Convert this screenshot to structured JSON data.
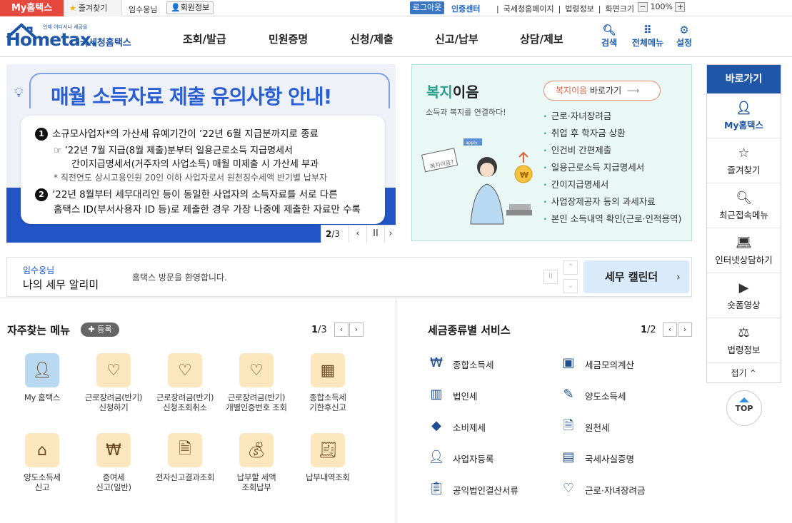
{
  "topbar": {
    "my_hometax": "My홈택스",
    "favorites": "즐겨찾기",
    "user_name": "임수웅님",
    "member_info": "회원정보",
    "logout": "로그아웃",
    "cert_center": "인증센터",
    "links": [
      "국세청홈페이지",
      "법령정보",
      "화면크기"
    ],
    "zoom": "100%"
  },
  "header": {
    "logo_small": "언제 어디서나 세금을",
    "logo_main": "Hometax.",
    "logo_sub": "국세청홈택스",
    "nav": [
      "조회/발급",
      "민원증명",
      "신청/제출",
      "신고/납부",
      "상담/제보"
    ],
    "icons": [
      {
        "label": "검색",
        "icon": "search-icon"
      },
      {
        "label": "전체메뉴",
        "icon": "grid-icon"
      },
      {
        "label": "설정",
        "icon": "gear-icon"
      }
    ]
  },
  "banner": {
    "title": "매월 소득자료 제출 유의사항 안내!",
    "item1": "소규모사업자*의 가산세 유예기간이 ’22년 6월 지급분까지로 종료",
    "item1_sub1": "’22년 7월 지급(8월 제출)분부터 일용근로소득 지급명세서",
    "item1_sub2": "간이지급명세서(거주자의 사업소득) 매월 미제출 시 가산세 부과",
    "item1_note": "* 직전연도 상시고용인원 20인 이하 사업자로서 원천징수세액 반기별 납부자",
    "item2_line1": "’22년 8월부터 세무대리인 등이 동일한 사업자의 소득자료를 서로 다른",
    "item2_line2": "홈택스 ID(부서사용자 ID 등)로 제출한 경우 가장 나중에 제출한 자료만 수록",
    "num1": "1",
    "num2": "2",
    "page_current": "2",
    "page_total": "/3"
  },
  "welfare": {
    "title_a": "복지",
    "title_b": "이음",
    "subtitle": "소득과 복지를 연결하다!",
    "link_a": "복지이음",
    "link_b": " 바로가기",
    "sign": "복지이음?",
    "apply": "apply",
    "items": [
      "근로·자녀장려금",
      "취업 후 학자금 상환",
      "인건비 간편제출",
      "일용근로소득 지급명세서",
      "간이지급명세서",
      "사업장제공자 등의 과세자료",
      "본인 소득내역 확인(근로·인적용역)"
    ]
  },
  "notice": {
    "user": "임수웅님",
    "title": "나의 세무 알리미",
    "message": "홈택스 방문을 환영합니다.",
    "calendar": "세무 캘린더"
  },
  "quick_menu": {
    "title": "자주찾는 메뉴",
    "register": "등록",
    "page_current": "1",
    "page_total": "/3",
    "items": [
      {
        "label": "My 홈택스",
        "icon": "user-icon"
      },
      {
        "label": "근로장려금(반기)\n신청하기",
        "icon": "heart-hand-icon"
      },
      {
        "label": "근로장려금(반기)\n신청조회취소",
        "icon": "heart-hand-icon"
      },
      {
        "label": "근로장려금(반기)\n개별인증번호 조회",
        "icon": "heart-hand-icon"
      },
      {
        "label": "종합소득세\n기한후신고",
        "icon": "calendar-icon"
      },
      {
        "label": "양도소득세\n신고",
        "icon": "house-icon"
      },
      {
        "label": "증여세\n신고(일반)",
        "icon": "money-icon"
      },
      {
        "label": "전자신고결과조회",
        "icon": "document-search-icon"
      },
      {
        "label": "납부할 세액\n조회납부",
        "icon": "money-bag-icon"
      },
      {
        "label": "납부내역조회",
        "icon": "receipt-icon"
      }
    ]
  },
  "tax_service": {
    "title": "세금종류별 서비스",
    "page_current": "1",
    "page_total": "/2",
    "left": [
      {
        "label": "종합소득세",
        "icon": "money-bag-icon"
      },
      {
        "label": "법인세",
        "icon": "building-icon"
      },
      {
        "label": "소비제세",
        "icon": "diamond-icon"
      },
      {
        "label": "사업자등록",
        "icon": "user-icon"
      },
      {
        "label": "공익법인결산서류",
        "icon": "clipboard-icon"
      }
    ],
    "right": [
      {
        "label": "세금모의계산",
        "icon": "calculator-icon"
      },
      {
        "label": "양도소득세",
        "icon": "document-pen-icon"
      },
      {
        "label": "원천세",
        "icon": "tax-document-icon"
      },
      {
        "label": "국세사실증명",
        "icon": "certificate-icon"
      },
      {
        "label": "근로·자녀장려금",
        "icon": "heart-hand-icon"
      }
    ]
  },
  "quicklinks": {
    "title": "바로가기",
    "items": [
      {
        "label": "My홈택스",
        "icon": "user-icon"
      },
      {
        "label": "즐겨찾기",
        "icon": "star-icon"
      },
      {
        "label": "최근접속메뉴",
        "icon": "recent-search-icon"
      },
      {
        "label": "인터넷상담하기",
        "icon": "laptop-chat-icon"
      },
      {
        "label": "숏폼영상",
        "icon": "play-icon"
      },
      {
        "label": "법령정보",
        "icon": "gavel-icon"
      }
    ],
    "fold": "접기",
    "top": "TOP"
  }
}
